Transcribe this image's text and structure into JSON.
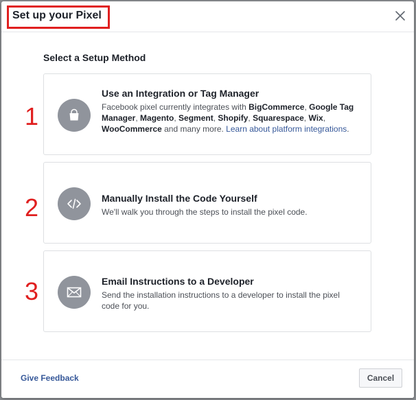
{
  "dialog": {
    "title": "Set up your Pixel",
    "close_icon": "close-icon",
    "section_label": "Select a Setup Method"
  },
  "options": [
    {
      "step": "1",
      "icon": "shopping-bag-icon",
      "title": "Use an Integration or Tag Manager",
      "desc_1": "Facebook pixel currently integrates with ",
      "platforms_1": "BigCommerce",
      "sep_1": ", ",
      "platforms_2": "Google Tag Manager",
      "sep_2": ", ",
      "platforms_3": "Magento",
      "sep_3": ", ",
      "platforms_4": "Segment",
      "sep_4": ", ",
      "platforms_5": "Shopify",
      "sep_5": ", ",
      "platforms_6": "Squarespace",
      "sep_6": ", ",
      "platforms_7": "Wix",
      "sep_7": ", ",
      "platforms_8": "WooCommerce",
      "desc_2": " and many more. ",
      "link": "Learn about platform integrations",
      "desc_end": "."
    },
    {
      "step": "2",
      "icon": "code-icon",
      "title": "Manually Install the Code Yourself",
      "desc": "We'll walk you through the steps to install the pixel code."
    },
    {
      "step": "3",
      "icon": "envelope-icon",
      "title": "Email Instructions to a Developer",
      "desc": "Send the installation instructions to a developer to install the pixel code for you."
    }
  ],
  "footer": {
    "feedback_label": "Give Feedback",
    "cancel_label": "Cancel"
  },
  "colors": {
    "annotation_red": "#e01f1f",
    "link_blue": "#365899",
    "icon_gray": "#90949c"
  }
}
